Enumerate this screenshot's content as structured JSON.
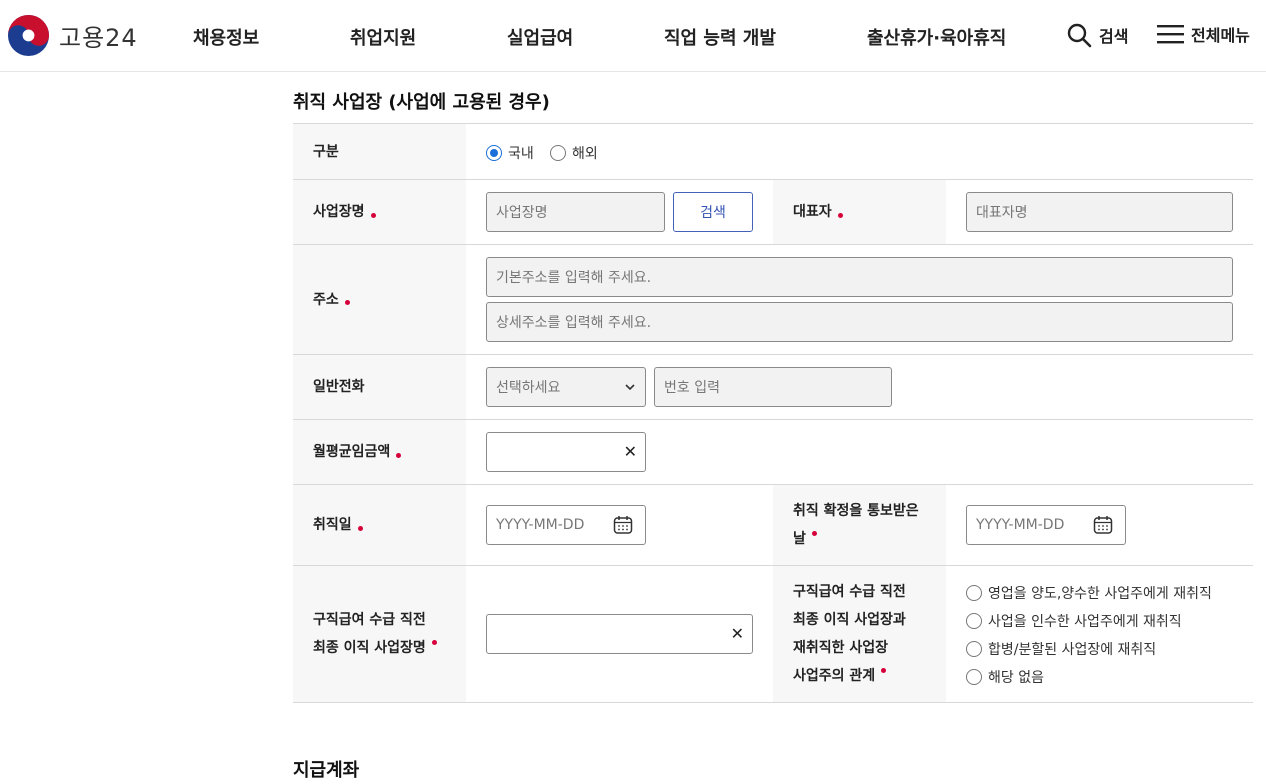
{
  "header": {
    "logo_text": "고용24",
    "nav": [
      "채용정보",
      "취업지원",
      "실업급여",
      "직업 능력 개발",
      "출산휴가·육아휴직"
    ],
    "search_label": "검색",
    "menu_label": "전체메뉴"
  },
  "section": {
    "title": "취직 사업장 (사업에 고용된 경우)",
    "next_title": "지급계좌"
  },
  "form": {
    "division": {
      "label": "구분",
      "options": [
        "국내",
        "해외"
      ],
      "selected": "국내"
    },
    "business_name": {
      "label": "사업장명",
      "placeholder": "사업장명",
      "search_button": "검색"
    },
    "representative": {
      "label": "대표자",
      "placeholder": "대표자명"
    },
    "address": {
      "label": "주소",
      "placeholder_basic": "기본주소를 입력해 주세요.",
      "placeholder_detail": "상세주소를 입력해 주세요."
    },
    "phone": {
      "label": "일반전화",
      "select_value": "선택하세요",
      "number_placeholder": "번호 입력"
    },
    "monthly_wage": {
      "label": "월평균임금액",
      "value": ""
    },
    "employment_date": {
      "label": "취직일",
      "placeholder": "YYYY-MM-DD"
    },
    "confirm_date": {
      "label_line1": "취직 확정을 통보받은",
      "label_line2": "날",
      "placeholder": "YYYY-MM-DD"
    },
    "last_workplace": {
      "label_line1": "구직급여 수급 직전",
      "label_line2": "최종 이직 사업장명",
      "value": ""
    },
    "relation": {
      "label_lines": [
        "구직급여 수급 직전",
        "최종 이직 사업장과",
        "재취직한 사업장",
        "사업주의 관계"
      ],
      "options": [
        "영업을 양도,양수한 사업주에게 재취직",
        "사업을 인수한 사업주에게 재취직",
        "합병/분할된 사업장에 재취직",
        "해당 없음"
      ]
    }
  },
  "colors": {
    "required_dot": "#d6003a",
    "accent": "#1a6fd8",
    "search_button": "#3454b4"
  }
}
